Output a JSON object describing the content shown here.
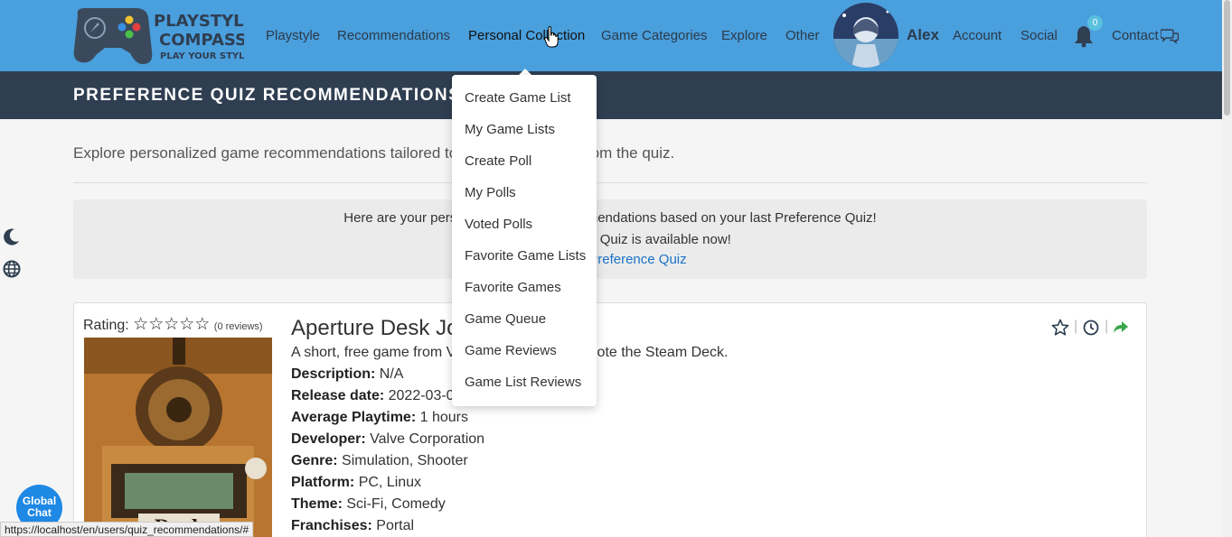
{
  "brand": {
    "line1": "PLAYSTYLE",
    "line2": "COMPASS",
    "tagline": "PLAY YOUR STYLE"
  },
  "nav": {
    "items": [
      {
        "label": "Playstyle"
      },
      {
        "label": "Recommendations"
      },
      {
        "label": "Personal Collection"
      },
      {
        "label": "Game Categories"
      },
      {
        "label": "Explore"
      },
      {
        "label": "Other"
      }
    ],
    "username": "Alex",
    "account": "Account",
    "social": "Social",
    "notification_count": "0",
    "contact": "Contact"
  },
  "page": {
    "title": "PREFERENCE QUIZ RECOMMENDATIONS",
    "intro": "Explore personalized game recommendations tailored to your preferences from the quiz."
  },
  "notice": {
    "line1": "Here are your personalized game recommendations based on your last Preference Quiz!",
    "line2": "A new Preference Quiz is available now!",
    "link": "Take the Preference Quiz"
  },
  "dropdown": {
    "items": [
      "Create Game List",
      "My Game Lists",
      "Create Poll",
      "My Polls",
      "Voted Polls",
      "Favorite Game Lists",
      "Favorite Games",
      "Game Queue",
      "Game Reviews",
      "Game List Reviews"
    ]
  },
  "game": {
    "rating_label": "Rating:",
    "stars": "☆☆☆☆☆",
    "reviews": "(0 reviews)",
    "title": "Aperture Desk Job",
    "summary": "A short, free game from Valve designed to promote the Steam Deck.",
    "fields": [
      {
        "label": "Description:",
        "value": "N/A"
      },
      {
        "label": "Release date:",
        "value": "2022-03-01"
      },
      {
        "label": "Average Playtime:",
        "value": "1 hours"
      },
      {
        "label": "Developer:",
        "value": "Valve Corporation"
      },
      {
        "label": "Genre:",
        "value": "Simulation, Shooter"
      },
      {
        "label": "Platform:",
        "value": "PC, Linux"
      },
      {
        "label": "Theme:",
        "value": "Sci-Fi, Comedy"
      },
      {
        "label": "Franchises:",
        "value": "Portal"
      }
    ]
  },
  "global_chat": {
    "line1": "Global",
    "line2": "Chat"
  },
  "status_url": "https://localhost/en/users/quiz_recommendations/#",
  "colors": {
    "navbar": "#4a9fdd",
    "header": "#2f3e51",
    "link": "#1a73c8",
    "chat": "#1e88e5"
  }
}
